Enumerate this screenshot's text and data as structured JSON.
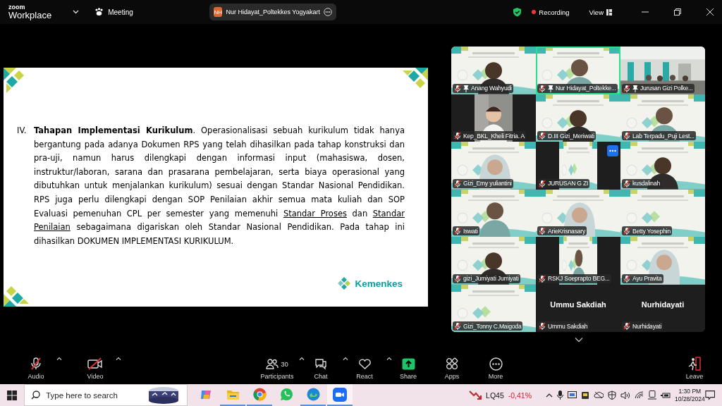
{
  "titlebar": {
    "brand_top": "zoom",
    "brand_bottom": "Workplace",
    "menu": "Meeting",
    "speaker": {
      "initials": "NH",
      "name": "Nur Hidayat_Poltekkes Yogyakart"
    },
    "recording": "Recording",
    "view": "View"
  },
  "slide": {
    "number": "IV.",
    "runs": [
      {
        "text": "Tahapan Implementasi Kurikulum",
        "bold": true,
        "underline": false
      },
      {
        "text": ". Operasionalisasi sebuah kurikulum tidak hanya bergantung pada adanya Dokumen RPS yang telah dihasilkan pada tahap konstruksi dan pra-uji, namun harus dilengkapi dengan informasi input (mahasiswa, dosen, instruktur/laboran, sarana dan prasarana pembelajaran, serta biaya operasional yang dibutuhkan untuk menjalankan kurikulum) sesuai dengan Standar Nasional Pendidikan. RPS juga perlu dilengkapi dengan SOP Penilaian akhir semua mata kuliah dan SOP Evaluasi pemenuhan CPL per semester yang memenuhi ",
        "bold": false,
        "underline": false
      },
      {
        "text": "Standar Proses",
        "bold": false,
        "underline": true
      },
      {
        "text": " dan ",
        "bold": false,
        "underline": false
      },
      {
        "text": "Standar Penilaian",
        "bold": false,
        "underline": true
      },
      {
        "text": " sebagaimana digariskan oleh Standar Nasional Pendidikan. Pada tahap ini dihasilkan DOKUMEN IMPLEMENTASI KURIKULUM.",
        "bold": false,
        "underline": false
      }
    ],
    "logo": "Kemenkes"
  },
  "gallery": [
    {
      "kind": "video",
      "name": "Anang Wahyudi",
      "pinned": true,
      "speaking": false,
      "pillarbox": false,
      "hovered": false
    },
    {
      "kind": "video",
      "name": "Nur Hidayat_Poltekke...",
      "pinned": true,
      "speaking": true,
      "pillarbox": false,
      "hovered": false
    },
    {
      "kind": "video",
      "name": "Jurusan Gizi Polke...",
      "pinned": true,
      "speaking": false,
      "pillarbox": false,
      "hovered": false
    },
    {
      "kind": "video",
      "name": "Kep_BKL_Kheli Fitria. A",
      "pinned": false,
      "speaking": false,
      "pillarbox": true,
      "hovered": false
    },
    {
      "kind": "video",
      "name": "D.III Gizi_Meriwati",
      "pinned": false,
      "speaking": false,
      "pillarbox": false,
      "hovered": false
    },
    {
      "kind": "video",
      "name": "Lab Terpadu_Puji Lest...",
      "pinned": false,
      "speaking": false,
      "pillarbox": false,
      "hovered": false
    },
    {
      "kind": "video",
      "name": "Gizi_Emy yuliantini",
      "pinned": false,
      "speaking": false,
      "pillarbox": false,
      "hovered": false
    },
    {
      "kind": "video",
      "name": "JURUSAN G ZI",
      "pinned": false,
      "speaking": false,
      "pillarbox": true,
      "hovered": true
    },
    {
      "kind": "video",
      "name": "kusdalinah",
      "pinned": false,
      "speaking": false,
      "pillarbox": false,
      "hovered": false
    },
    {
      "kind": "video",
      "name": "Iswati",
      "pinned": false,
      "speaking": false,
      "pillarbox": false,
      "hovered": false
    },
    {
      "kind": "video",
      "name": "ArieKrisnasary",
      "pinned": false,
      "speaking": false,
      "pillarbox": false,
      "hovered": false
    },
    {
      "kind": "video",
      "name": "Betty Yosephin",
      "pinned": false,
      "speaking": false,
      "pillarbox": false,
      "hovered": false
    },
    {
      "kind": "video",
      "name": "gizi_Jumiyati Jumiyati",
      "pinned": false,
      "speaking": false,
      "pillarbox": false,
      "hovered": false
    },
    {
      "kind": "video",
      "name": "RSKJ Soeprapto BEG...",
      "pinned": false,
      "speaking": false,
      "pillarbox": true,
      "hovered": false
    },
    {
      "kind": "video",
      "name": "Ayu Pravita",
      "pinned": false,
      "speaking": false,
      "pillarbox": false,
      "hovered": false
    },
    {
      "kind": "video",
      "name": "Gizi_Tonny C.Maigoda",
      "pinned": false,
      "speaking": false,
      "pillarbox": false,
      "hovered": false
    },
    {
      "kind": "name",
      "title": "Ummu Sakdiah",
      "name": "Ummu Sakdiah",
      "pinned": false,
      "speaking": false,
      "hovered": false
    },
    {
      "kind": "name",
      "title": "Nurhidayati",
      "name": "Nurhidayati",
      "pinned": false,
      "speaking": false,
      "hovered": false
    }
  ],
  "toolbar": {
    "left": [
      {
        "kind": "audio",
        "label": "Audio",
        "muted": true
      },
      {
        "kind": "video",
        "label": "Video",
        "muted": true
      }
    ],
    "center": [
      {
        "kind": "participants",
        "label": "Participants",
        "count": "30",
        "caret": true
      },
      {
        "kind": "chat",
        "label": "Chat",
        "caret": true
      },
      {
        "kind": "react",
        "label": "React",
        "caret": true
      },
      {
        "kind": "share",
        "label": "Share",
        "caret": false
      },
      {
        "kind": "apps",
        "label": "Apps",
        "caret": false
      },
      {
        "kind": "more",
        "label": "More",
        "caret": false
      }
    ],
    "leave": "Leave"
  },
  "taskbar": {
    "search": {
      "placeholder": "Type here to search"
    },
    "apps": [
      {
        "kind": "copilot",
        "running": false,
        "active": false
      },
      {
        "kind": "folder",
        "running": true,
        "active": false
      },
      {
        "kind": "chrome",
        "running": true,
        "active": false
      },
      {
        "kind": "whatsapp",
        "running": false,
        "active": false
      },
      {
        "kind": "edge",
        "running": true,
        "active": false
      },
      {
        "kind": "zoom",
        "running": true,
        "active": true
      }
    ],
    "stock": {
      "name": "LQ45",
      "change": "-0,41%"
    },
    "time": "1:30 PM",
    "date": "10/28/2024"
  }
}
